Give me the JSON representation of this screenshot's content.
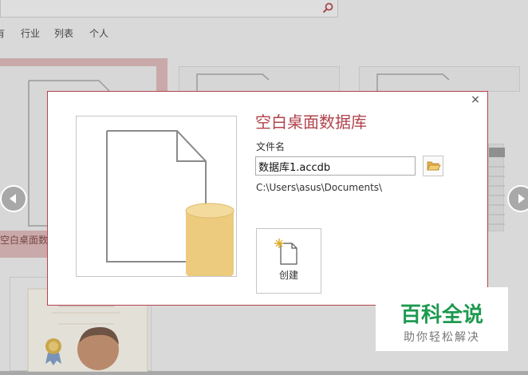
{
  "background": {
    "filters": [
      "有",
      "行业",
      "列表",
      "个人"
    ],
    "template_label": "空白桌面数"
  },
  "dialog": {
    "title": "空白桌面数据库",
    "file_label": "文件名",
    "file_value": "数据库1.accdb",
    "path": "C:\\Users\\asus\\Documents\\",
    "create_label": "创建",
    "close_glyph": "×"
  },
  "watermark": {
    "title": "百科全说",
    "subtitle": "助你轻松解决"
  },
  "colors": {
    "accent": "#b0434c",
    "database_cylinder": "#eccb7f",
    "watermark_green": "#1e9a50"
  },
  "icons": {
    "search": "search-icon",
    "folder": "folder-open-icon",
    "new_file": "new-file-icon",
    "prev": "chevron-left-icon",
    "next": "chevron-right-icon",
    "close": "close-icon"
  }
}
